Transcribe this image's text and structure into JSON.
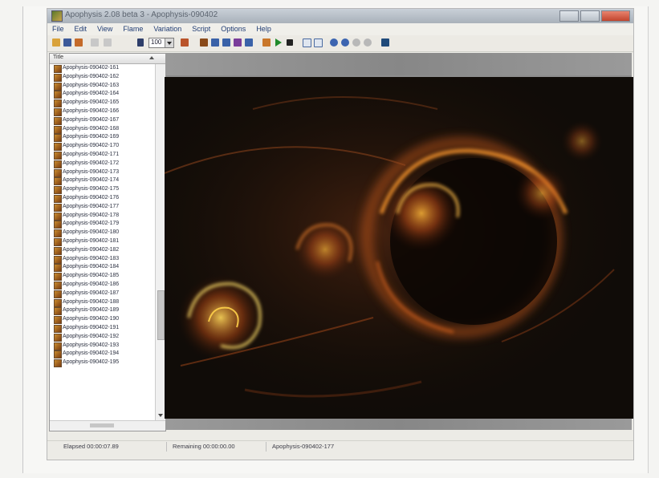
{
  "window": {
    "title": "Apophysis 2.08 beta 3 - Apophysis-090402"
  },
  "menu": [
    "File",
    "Edit",
    "View",
    "Flame",
    "Variation",
    "Script",
    "Options",
    "Help"
  ],
  "toolbar": {
    "zoom_value": "100"
  },
  "flame_list": {
    "header": "Title",
    "items": [
      "Apophysis-090402-161",
      "Apophysis-090402-162",
      "Apophysis-090402-163",
      "Apophysis-090402-164",
      "Apophysis-090402-165",
      "Apophysis-090402-166",
      "Apophysis-090402-167",
      "Apophysis-090402-168",
      "Apophysis-090402-169",
      "Apophysis-090402-170",
      "Apophysis-090402-171",
      "Apophysis-090402-172",
      "Apophysis-090402-173",
      "Apophysis-090402-174",
      "Apophysis-090402-175",
      "Apophysis-090402-176",
      "Apophysis-090402-177",
      "Apophysis-090402-178",
      "Apophysis-090402-179",
      "Apophysis-090402-180",
      "Apophysis-090402-181",
      "Apophysis-090402-182",
      "Apophysis-090402-183",
      "Apophysis-090402-184",
      "Apophysis-090402-185",
      "Apophysis-090402-186",
      "Apophysis-090402-187",
      "Apophysis-090402-188",
      "Apophysis-090402-189",
      "Apophysis-090402-190",
      "Apophysis-090402-191",
      "Apophysis-090402-192",
      "Apophysis-090402-193",
      "Apophysis-090402-194",
      "Apophysis-090402-195"
    ]
  },
  "status": {
    "elapsed": "Elapsed 00:00:07.89",
    "remaining": "Remaining 00:00:00.00",
    "current_flame": "Apophysis-090402-177"
  }
}
